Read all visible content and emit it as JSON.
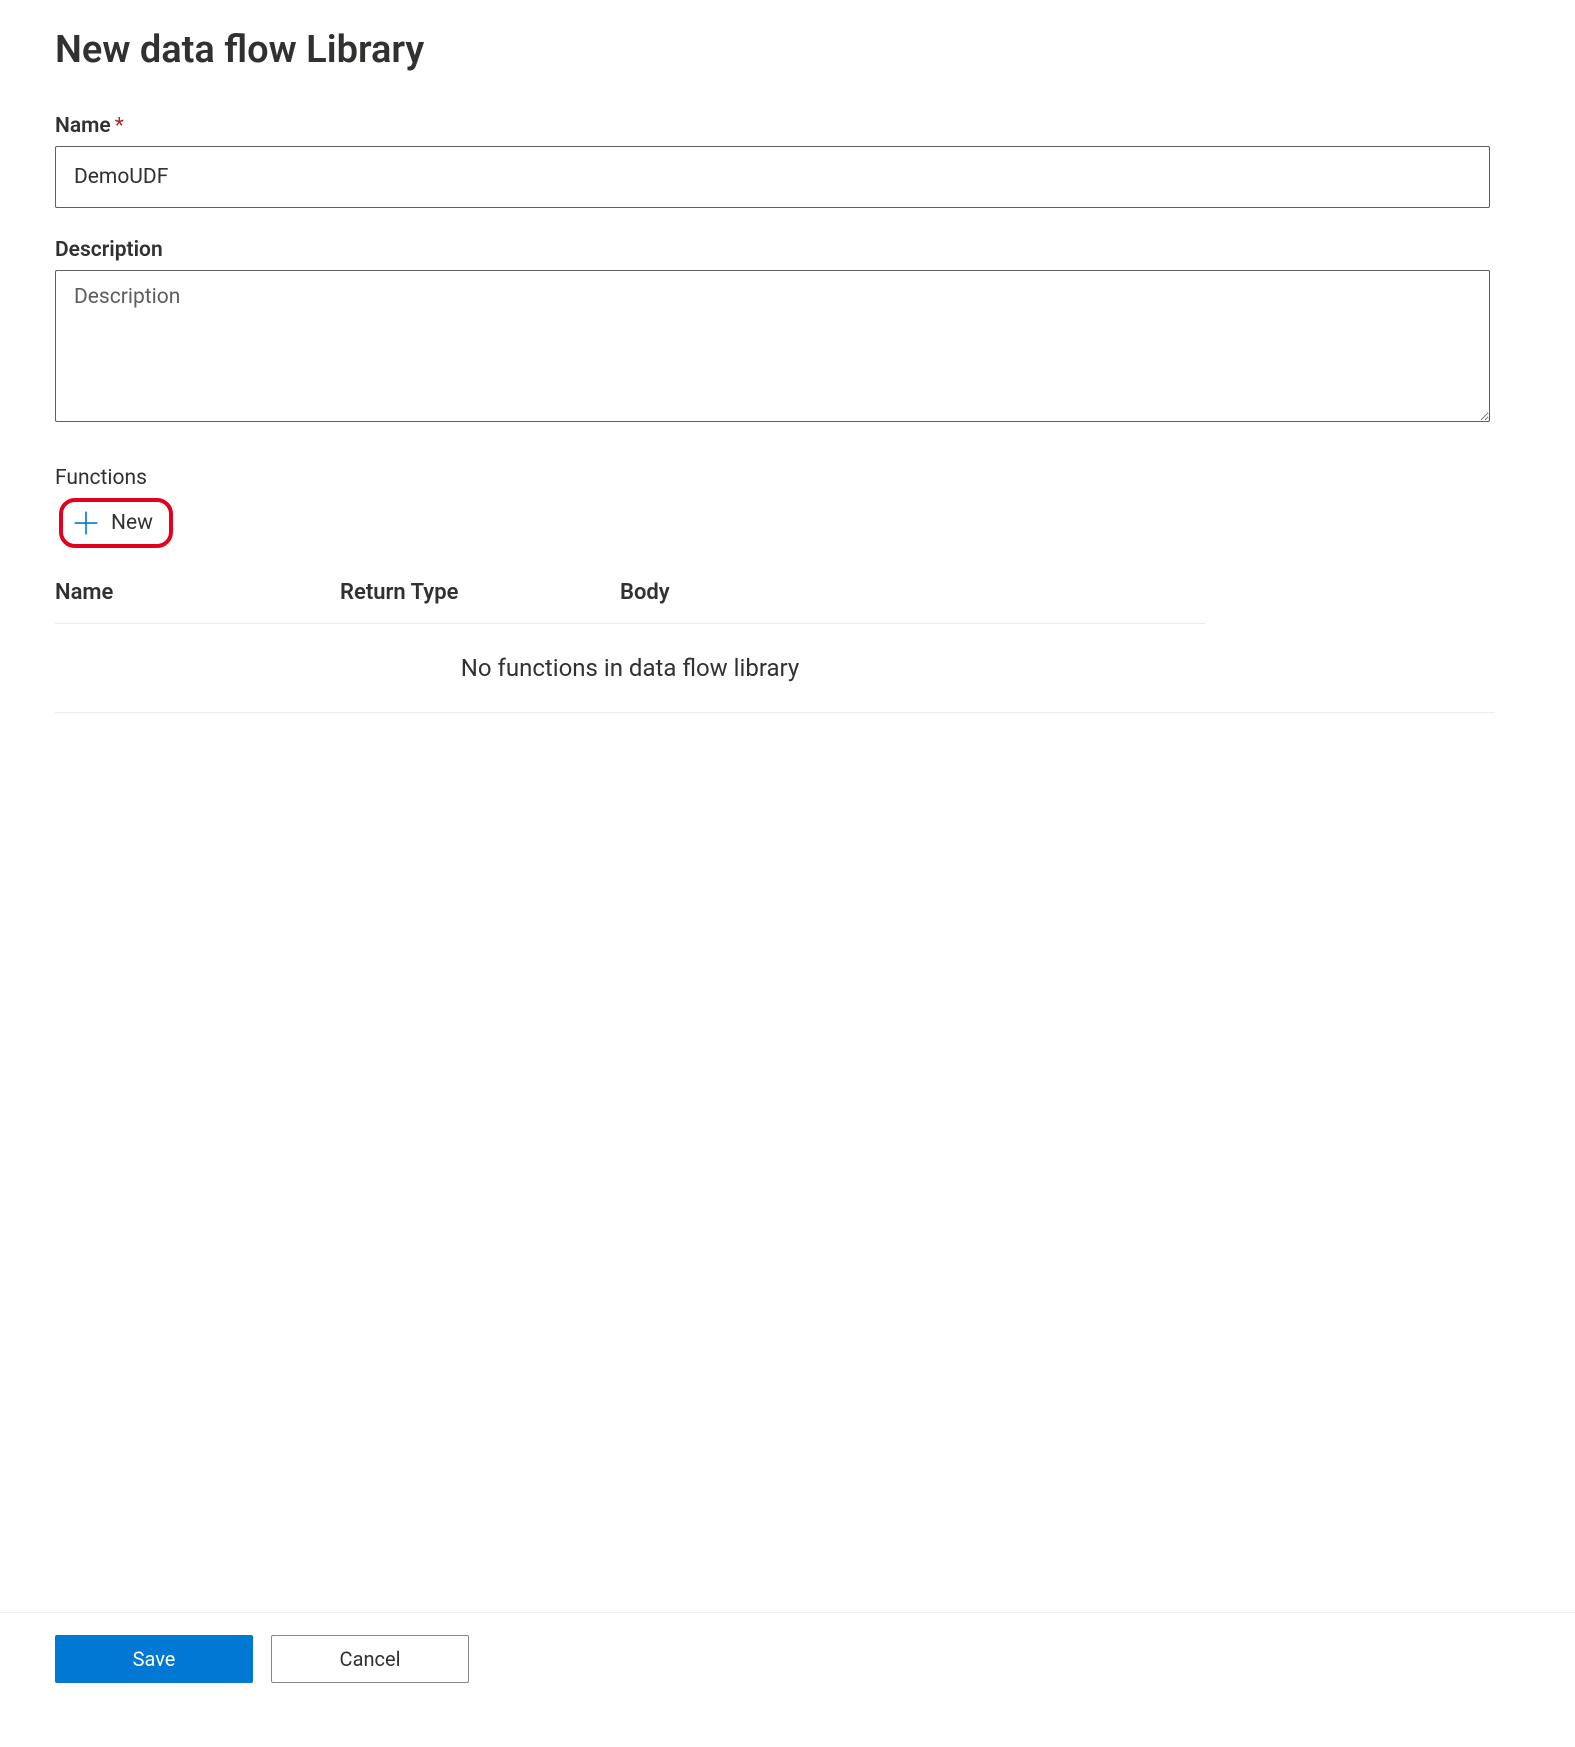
{
  "page": {
    "title": "New data flow Library"
  },
  "form": {
    "name": {
      "label": "Name",
      "required_marker": "*",
      "value": "DemoUDF"
    },
    "description": {
      "label": "Description",
      "placeholder": "Description",
      "value": ""
    }
  },
  "functions": {
    "label": "Functions",
    "new_button_label": "New",
    "columns": {
      "name": "Name",
      "return_type": "Return Type",
      "body": "Body"
    },
    "empty_message": "No functions in data flow library",
    "rows": []
  },
  "footer": {
    "save_label": "Save",
    "cancel_label": "Cancel"
  },
  "icons": {
    "plus": "plus-icon"
  },
  "colors": {
    "accent": "#0078d4",
    "annotation": "#e1001e"
  }
}
